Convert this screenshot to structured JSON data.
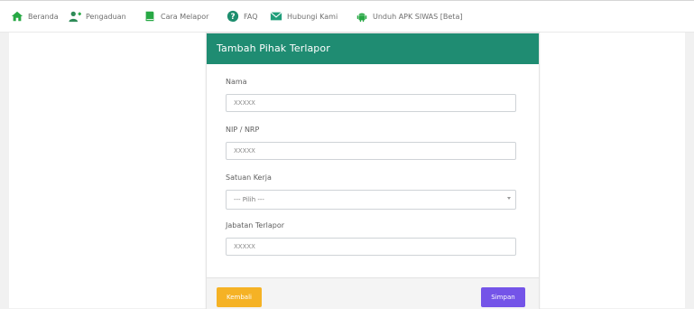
{
  "nav": {
    "items": [
      {
        "label": "Beranda",
        "icon": "home-icon",
        "color": "#27a844"
      },
      {
        "label": "Pengaduan",
        "icon": "user-plus-icon",
        "color": "#27a844"
      },
      {
        "label": "Cara Melapor",
        "icon": "book-icon",
        "color": "#27a844"
      },
      {
        "label": "FAQ",
        "icon": "question-circle-icon",
        "color": "#27a844"
      },
      {
        "label": "Hubungi Kami",
        "icon": "envelope-icon",
        "color": "#27a844"
      },
      {
        "label": "Unduh APK SIWAS [Beta]",
        "icon": "android-icon",
        "color": "#27a844"
      }
    ]
  },
  "modal": {
    "title": "Tambah Pihak Terlapor",
    "header_color": "#1f8c72",
    "fields": {
      "nama": {
        "label": "Nama",
        "placeholder": "XXXXX"
      },
      "nip": {
        "label": "NIP / NRP",
        "placeholder": "XXXXX"
      },
      "satuan": {
        "label": "Satuan Kerja",
        "selected": "--- Pilih ---"
      },
      "jabatan": {
        "label": "Jabatan Terlapor",
        "placeholder": "XXXXX"
      }
    },
    "buttons": {
      "back": {
        "label": "Kembali",
        "color": "#f5b225"
      },
      "save": {
        "label": "Simpan",
        "color": "#7454e8"
      }
    }
  }
}
